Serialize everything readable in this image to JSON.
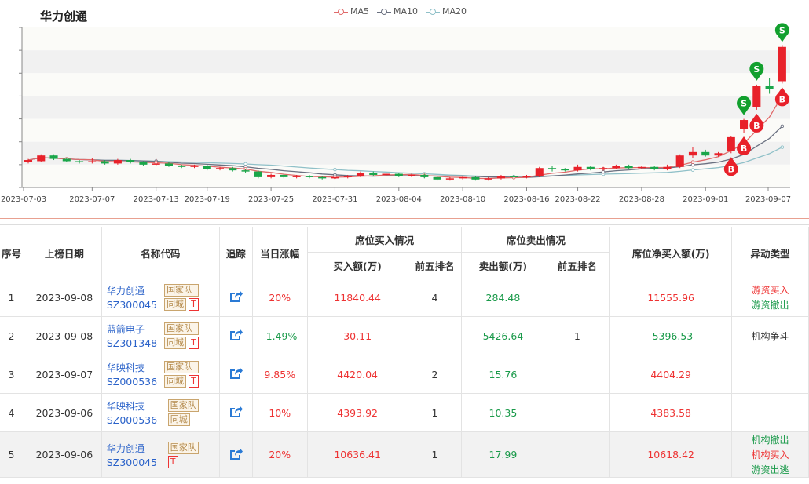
{
  "chart": {
    "title": "华力创通",
    "legend": [
      {
        "label": "MA5",
        "color": "#e06a6a"
      },
      {
        "label": "MA10",
        "color": "#6a7080"
      },
      {
        "label": "MA20",
        "color": "#8fc0c8"
      }
    ],
    "x_ticks": [
      "2023-07-03",
      "2023-07-07",
      "2023-07-13",
      "2023-07-19",
      "2023-07-25",
      "2023-07-31",
      "2023-08-04",
      "2023-08-10",
      "2023-08-16",
      "2023-08-22",
      "2023-08-28",
      "2023-09-01",
      "2023-09-07"
    ],
    "colors": {
      "up": "#e8212a",
      "down": "#1aa64a",
      "buy_marker": "#e8212a",
      "sell_marker": "#12a02e"
    },
    "markers": {
      "buy": "B",
      "sell": "S"
    }
  },
  "chart_data": {
    "type": "candlestick",
    "title": "华力创通",
    "candles": [
      {
        "o": 9.2,
        "c": 9.4,
        "h": 9.5,
        "l": 9.1
      },
      {
        "o": 9.3,
        "c": 9.8,
        "h": 9.9,
        "l": 9.2
      },
      {
        "o": 9.8,
        "c": 9.5,
        "h": 9.9,
        "l": 9.4
      },
      {
        "o": 9.5,
        "c": 9.3,
        "h": 9.6,
        "l": 9.2
      },
      {
        "o": 9.3,
        "c": 9.2,
        "h": 9.4,
        "l": 9.1
      },
      {
        "o": 9.2,
        "c": 9.3,
        "h": 9.6,
        "l": 9.1
      },
      {
        "o": 9.3,
        "c": 9.1,
        "h": 9.4,
        "l": 9.0
      },
      {
        "o": 9.1,
        "c": 9.4,
        "h": 9.5,
        "l": 9.0
      },
      {
        "o": 9.4,
        "c": 9.2,
        "h": 9.5,
        "l": 9.1
      },
      {
        "o": 9.2,
        "c": 9.0,
        "h": 9.3,
        "l": 8.9
      },
      {
        "o": 9.0,
        "c": 9.1,
        "h": 9.5,
        "l": 8.9
      },
      {
        "o": 9.1,
        "c": 8.9,
        "h": 9.2,
        "l": 8.8
      },
      {
        "o": 8.9,
        "c": 8.8,
        "h": 9.0,
        "l": 8.7
      },
      {
        "o": 8.8,
        "c": 8.9,
        "h": 9.0,
        "l": 8.7
      },
      {
        "o": 8.9,
        "c": 8.6,
        "h": 9.0,
        "l": 8.5
      },
      {
        "o": 8.6,
        "c": 8.7,
        "h": 8.8,
        "l": 8.5
      },
      {
        "o": 8.7,
        "c": 8.5,
        "h": 8.8,
        "l": 8.4
      },
      {
        "o": 8.5,
        "c": 8.4,
        "h": 8.6,
        "l": 8.3
      },
      {
        "o": 8.4,
        "c": 7.9,
        "h": 8.5,
        "l": 7.8
      },
      {
        "o": 7.9,
        "c": 8.1,
        "h": 8.2,
        "l": 7.8
      },
      {
        "o": 8.1,
        "c": 7.9,
        "h": 8.2,
        "l": 7.8
      },
      {
        "o": 7.9,
        "c": 8.0,
        "h": 8.1,
        "l": 7.8
      },
      {
        "o": 8.0,
        "c": 7.9,
        "h": 8.1,
        "l": 7.8
      },
      {
        "o": 7.9,
        "c": 7.8,
        "h": 8.0,
        "l": 7.7
      },
      {
        "o": 7.8,
        "c": 7.9,
        "h": 8.0,
        "l": 7.7
      },
      {
        "o": 7.9,
        "c": 8.0,
        "h": 8.1,
        "l": 7.8
      },
      {
        "o": 8.0,
        "c": 8.3,
        "h": 8.4,
        "l": 7.9
      },
      {
        "o": 8.3,
        "c": 8.1,
        "h": 8.4,
        "l": 8.0
      },
      {
        "o": 8.1,
        "c": 8.2,
        "h": 8.3,
        "l": 8.0
      },
      {
        "o": 8.2,
        "c": 8.0,
        "h": 8.3,
        "l": 7.9
      },
      {
        "o": 8.0,
        "c": 8.1,
        "h": 8.2,
        "l": 7.9
      },
      {
        "o": 8.1,
        "c": 7.9,
        "h": 8.2,
        "l": 7.8
      },
      {
        "o": 7.9,
        "c": 7.7,
        "h": 8.0,
        "l": 7.6
      },
      {
        "o": 7.7,
        "c": 7.8,
        "h": 7.9,
        "l": 7.6
      },
      {
        "o": 7.8,
        "c": 7.9,
        "h": 8.0,
        "l": 7.7
      },
      {
        "o": 7.9,
        "c": 7.7,
        "h": 8.0,
        "l": 7.6
      },
      {
        "o": 7.7,
        "c": 7.8,
        "h": 7.9,
        "l": 7.6
      },
      {
        "o": 7.8,
        "c": 8.0,
        "h": 8.1,
        "l": 7.7
      },
      {
        "o": 8.0,
        "c": 7.9,
        "h": 8.1,
        "l": 7.8
      },
      {
        "o": 7.9,
        "c": 8.0,
        "h": 8.1,
        "l": 7.8
      },
      {
        "o": 8.0,
        "c": 8.7,
        "h": 8.8,
        "l": 7.9
      },
      {
        "o": 8.7,
        "c": 8.6,
        "h": 8.9,
        "l": 8.4
      },
      {
        "o": 8.6,
        "c": 8.5,
        "h": 8.7,
        "l": 8.4
      },
      {
        "o": 8.5,
        "c": 8.8,
        "h": 9.0,
        "l": 8.4
      },
      {
        "o": 8.8,
        "c": 8.6,
        "h": 8.9,
        "l": 8.5
      },
      {
        "o": 8.6,
        "c": 8.7,
        "h": 8.8,
        "l": 8.5
      },
      {
        "o": 8.7,
        "c": 8.9,
        "h": 9.0,
        "l": 8.6
      },
      {
        "o": 8.9,
        "c": 8.7,
        "h": 9.0,
        "l": 8.6
      },
      {
        "o": 8.7,
        "c": 8.8,
        "h": 8.9,
        "l": 8.6
      },
      {
        "o": 8.8,
        "c": 8.6,
        "h": 8.9,
        "l": 8.5
      },
      {
        "o": 8.6,
        "c": 8.8,
        "h": 9.0,
        "l": 8.5
      },
      {
        "o": 8.8,
        "c": 9.8,
        "h": 9.9,
        "l": 8.7
      },
      {
        "o": 9.8,
        "c": 10.1,
        "h": 10.5,
        "l": 9.6
      },
      {
        "o": 10.1,
        "c": 9.8,
        "h": 10.3,
        "l": 9.7
      },
      {
        "o": 9.8,
        "c": 10.0,
        "h": 10.1,
        "l": 9.7
      },
      {
        "o": 10.2,
        "c": 11.4,
        "h": 11.5,
        "l": 10.0
      },
      {
        "o": 12.1,
        "c": 12.9,
        "h": 13.0,
        "l": 11.8
      },
      {
        "o": 14.0,
        "c": 15.9,
        "h": 16.0,
        "l": 13.8
      },
      {
        "o": 15.9,
        "c": 15.6,
        "h": 16.6,
        "l": 15.2
      },
      {
        "o": 16.3,
        "c": 19.3,
        "h": 19.4,
        "l": 16.1
      }
    ],
    "buy_marks": [
      55,
      56,
      57,
      59
    ],
    "sell_marks": [
      56,
      57,
      59
    ],
    "ylim": [
      7.0,
      21.0
    ]
  },
  "table": {
    "headers": {
      "index": "序号",
      "date": "上榜日期",
      "name": "名称代码",
      "track": "追踪",
      "change": "当日涨幅",
      "buy_group": "席位买入情况",
      "sell_group": "席位卖出情况",
      "net": "席位净买入额(万)",
      "type": "异动类型",
      "buy_amount": "买入额(万)",
      "buy_rank": "前五排名",
      "sell_amount": "卖出额(万)",
      "sell_rank": "前五排名"
    },
    "rows": [
      {
        "index": "1",
        "date": "2023-09-08",
        "name": "华力创通",
        "code": "SZ300045",
        "tags": [
          "国家队",
          "同城"
        ],
        "t": "T",
        "change": "20%",
        "dir": "up",
        "buy": "11840.44",
        "buy_rank": "4",
        "sell": "284.48",
        "sell_rank": "",
        "net": "11555.96",
        "net_dir": "up",
        "types": [
          {
            "t": "游资买入",
            "c": "up"
          },
          {
            "t": "游资撤出",
            "c": "down"
          }
        ]
      },
      {
        "index": "2",
        "date": "2023-09-08",
        "name": "蓝箭电子",
        "code": "SZ301348",
        "tags": [
          "国家队",
          "同城"
        ],
        "t": "T",
        "change": "-1.49%",
        "dir": "down",
        "buy": "30.11",
        "buy_rank": "",
        "sell": "5426.64",
        "sell_rank": "1",
        "net": "-5396.53",
        "net_dir": "down",
        "types": [
          {
            "t": "机构争斗",
            "c": "plain"
          }
        ]
      },
      {
        "index": "3",
        "date": "2023-09-07",
        "name": "华映科技",
        "code": "SZ000536",
        "tags": [
          "国家队",
          "同城"
        ],
        "t": "T",
        "change": "9.85%",
        "dir": "up",
        "buy": "4420.04",
        "buy_rank": "2",
        "sell": "15.76",
        "sell_rank": "",
        "net": "4404.29",
        "net_dir": "up",
        "types": []
      },
      {
        "index": "4",
        "date": "2023-09-06",
        "name": "华映科技",
        "code": "SZ000536",
        "tags": [
          "国家队",
          "同城"
        ],
        "t": "",
        "change": "10%",
        "dir": "up",
        "buy": "4393.92",
        "buy_rank": "1",
        "sell": "10.35",
        "sell_rank": "",
        "net": "4383.58",
        "net_dir": "up",
        "types": []
      },
      {
        "index": "5",
        "date": "2023-09-06",
        "name": "华力创通",
        "code": "SZ300045",
        "tags": [
          "国家队"
        ],
        "t": "T",
        "change": "20%",
        "dir": "up",
        "buy": "10636.41",
        "buy_rank": "1",
        "sell": "17.99",
        "sell_rank": "",
        "net": "10618.42",
        "net_dir": "up",
        "types": [
          {
            "t": "机构撤出",
            "c": "down"
          },
          {
            "t": "机构买入",
            "c": "up"
          },
          {
            "t": "游资出逃",
            "c": "down"
          }
        ]
      }
    ]
  }
}
